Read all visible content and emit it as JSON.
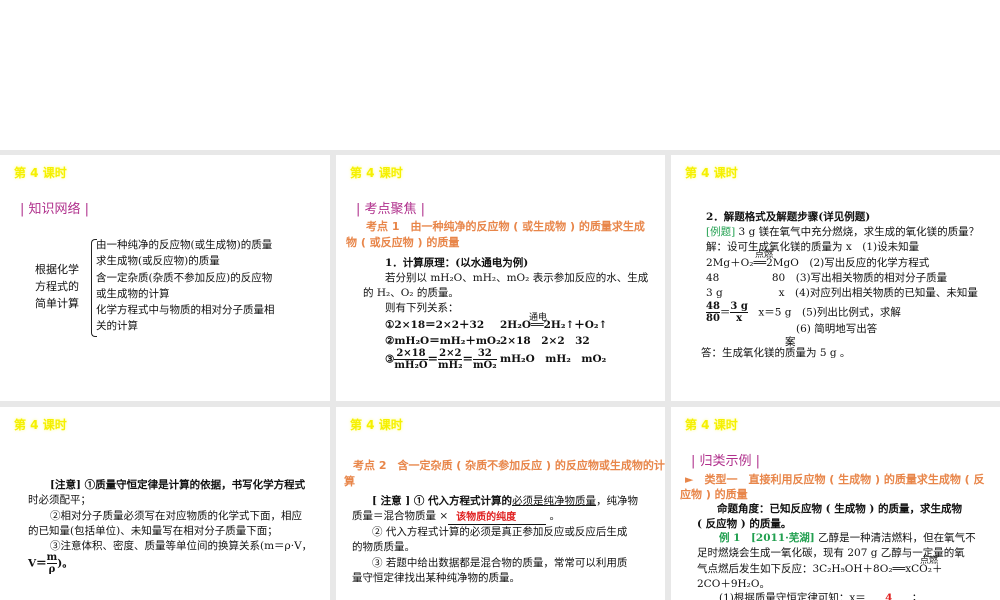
{
  "lesson_title": "第 4 课时",
  "s1": {
    "section": "| 知识网络 |",
    "root": [
      "根据化学",
      "方程式的",
      "简单计算"
    ],
    "items": [
      "由一种纯净的反应物(或生成物)的质量",
      "求生成物(或反应物)的质量",
      "含一定杂质(杂质不参加反应)的反应物",
      "或生成物的计算",
      "化学方程式中与物质的相对分子质量相",
      "关的计算"
    ]
  },
  "s2": {
    "section": "| 考点聚焦 |",
    "heading1": "考点 1　由一种纯净的反应物 ( 或生成物 ) 的质量求生成",
    "heading2": "物 ( 或反应物 ) 的质量",
    "lines": [
      "1．计算原理：(以水通电为例)",
      "若分别以 mH₂O、mH₂、mO₂ 表示参加反应的水、生成",
      "的 H₂、O₂ 的质量。",
      "则有下列关系：",
      "①2×18＝2×2＋32",
      "2H₂O══2H₂↑＋O₂↑",
      "②mH₂O＝mH₂＋mO₂",
      "2×18　2×2　32",
      "mH₂O　mH₂　mO₂"
    ],
    "cond": "通电",
    "f": [
      "2×18",
      "mH₂O",
      "2×2",
      "mH₂",
      "32",
      "mO₂"
    ]
  },
  "s3": {
    "lines": [
      "2．解题格式及解题步骤(详见例题)",
      "[例题]",
      "3 g 镁在氧气中充分燃烧，求生成的氧化镁的质量？",
      "解：设可生成氧化镁的质量为 x　(1)设未知量",
      "2Mg＋O₂══2MgO　(2)写出反应的化学方程式",
      "48　　　　　80　(3)写出相关物质的相对分子质量",
      "3 g　　　　　 x　(4)对应列出相关物质的已知量、未知量",
      "x＝5 g　(5)列出比例式，求解",
      "(6) 简明地写出答",
      "案",
      "答：生成氧化镁的质量为 5 g 。"
    ],
    "cond": "点燃",
    "f": [
      "48",
      "80",
      "3 g",
      "x"
    ]
  },
  "s4": {
    "lines": [
      "[注意] ①质量守恒定律是计算的依据，书写化学方程式",
      "时必须配平；",
      "②相对分子质量必须写在对应物质的化学式下面，相应",
      "的已知量(包括单位)、未知量写在相对分子质量下面；",
      "③注意体积、密度、质量等单位间的换算关系(m＝ρ·V，",
      "V＝",
      "m",
      "ρ",
      ")。"
    ]
  },
  "s5": {
    "heading1": "考点 2　含一定杂质 ( 杂质不参加反应 ) 的反应物或生成物的计",
    "heading2": "算",
    "lines": [
      "[ 注意 ] ① 代入方程式计算的",
      "必须是纯净物质量",
      "，纯净物",
      "质量＝混合物质量 ×",
      "该物质的纯度",
      "。",
      "② 代入方程式计算的必须是真正参加反应或反应后生成",
      "的物质质量。",
      "③ 若题中给出数据都是混合物的质量，常常可以利用质",
      "量守恒定律找出某种纯净物的质量。"
    ]
  },
  "s6": {
    "section": "| 归类示例 |",
    "heading1": "►　类型一　直接利用反应物 ( 生成物 ) 的质量求生成物 ( 反",
    "heading2": "应物 ) 的质量",
    "lines": [
      "命题角度：已知反应物 ( 生成物 ) 的质量，求生成物",
      "( 反应物 ) 的质量。",
      "例 1　[2011·芜湖]",
      "乙醇是一种清洁燃料，但在氧气不",
      "足时燃烧会生成一氧化碳，现有 207 g 乙醇与一定量的氧",
      "气点燃后发生如下反应：3C₂H₅OH＋8O₂══xCO₂＋",
      "2CO＋9H₂O。",
      "(1)根据质量守恒定律可知：x＝",
      "4",
      "；"
    ],
    "cond": "点燃"
  }
}
